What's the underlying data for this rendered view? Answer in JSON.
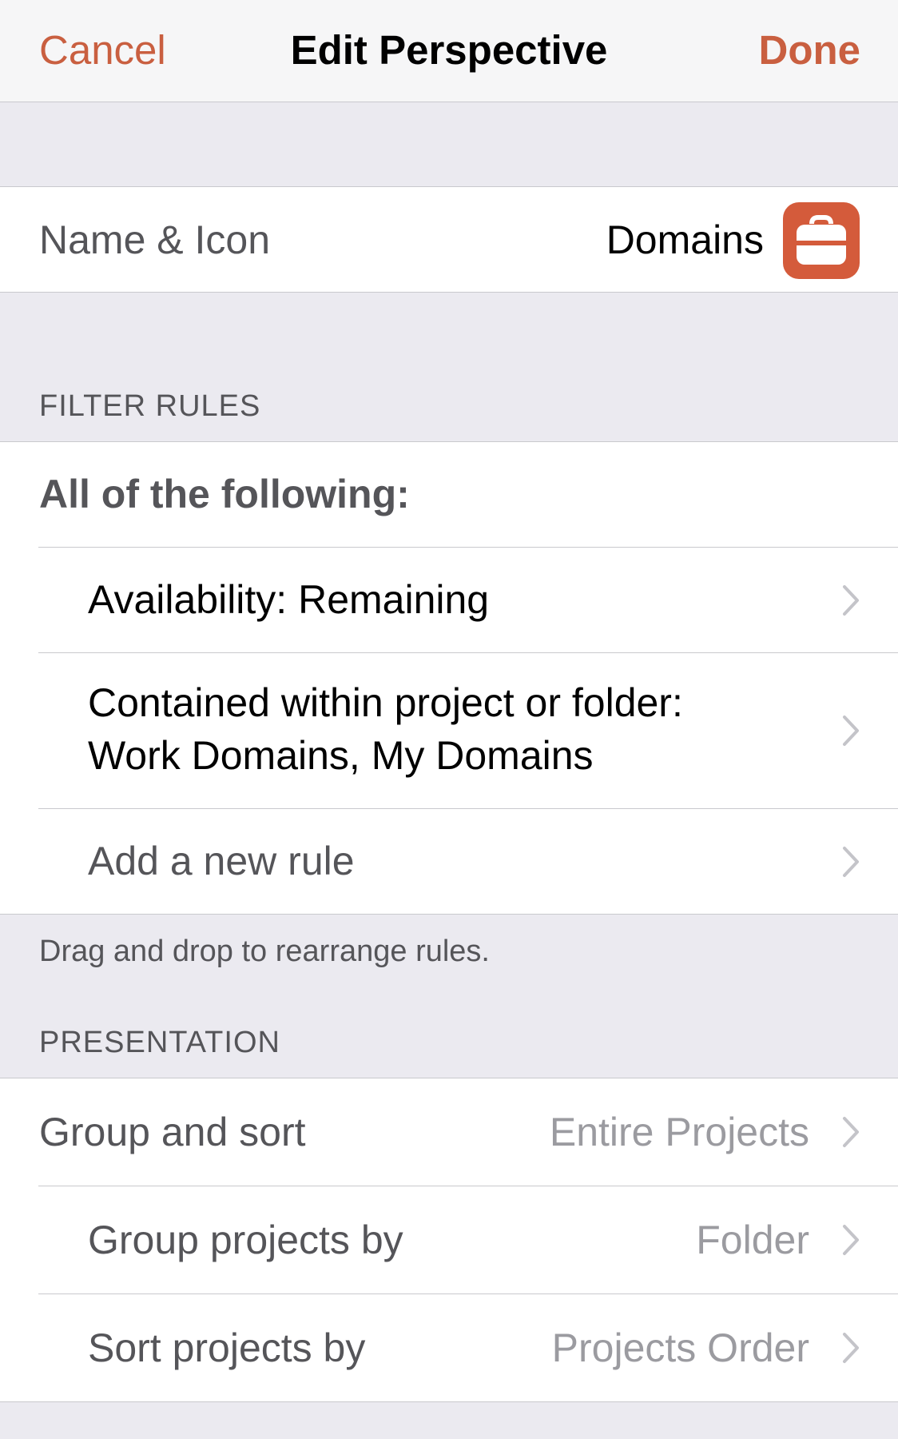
{
  "nav": {
    "cancel_label": "Cancel",
    "title": "Edit Perspective",
    "done_label": "Done"
  },
  "name_icon": {
    "label": "Name & Icon",
    "value": "Domains",
    "icon": "briefcase-icon",
    "icon_color": "#d45b3b"
  },
  "filter_rules": {
    "header": "FILTER RULES",
    "mode": "All of the following:",
    "rules": [
      {
        "label": "Availability: Remaining"
      },
      {
        "line1": "Contained within project or folder:",
        "line2": "Work Domains, My Domains"
      }
    ],
    "add_rule_label": "Add a new rule",
    "footer": "Drag and drop to rearrange rules."
  },
  "presentation": {
    "header": "PRESENTATION",
    "rows": [
      {
        "label": "Group and sort",
        "value": "Entire Projects"
      },
      {
        "label": "Group projects by",
        "value": "Folder"
      },
      {
        "label": "Sort projects by",
        "value": "Projects Order"
      }
    ]
  },
  "colors": {
    "accent": "#c95f40",
    "background": "#ebeaf0"
  }
}
